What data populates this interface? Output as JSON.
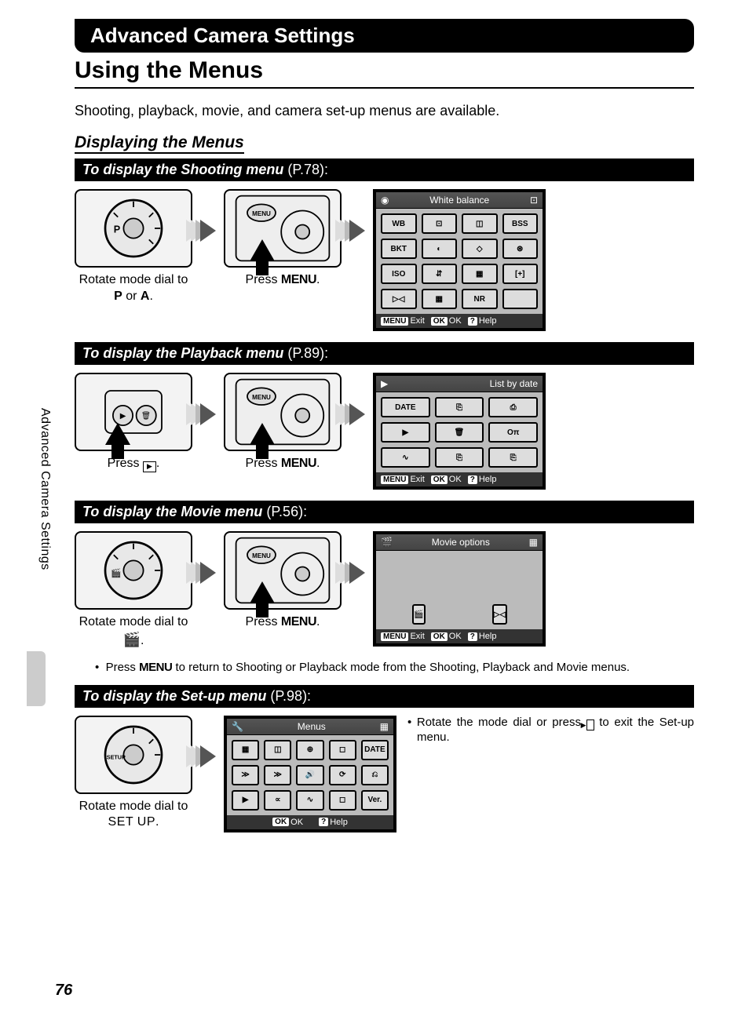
{
  "chapter": "Advanced Camera Settings",
  "section": "Using the Menus",
  "intro": "Shooting, playback, movie, and camera set-up menus are available.",
  "subhead": "Displaying the Menus",
  "side_tab": "Advanced Camera Settings",
  "page_number": "76",
  "bars": {
    "shooting": {
      "bold": "To display the Shooting menu",
      "ref": " (P.78):"
    },
    "playback": {
      "bold": "To display the Playback menu",
      "ref": " (P.89):"
    },
    "movie": {
      "bold": "To display the Movie menu",
      "ref": " (P.56):"
    },
    "setup": {
      "bold": "To display the Set-up menu",
      "ref": " (P.98):"
    }
  },
  "captions": {
    "rotate_pa_1": "Rotate mode dial to",
    "rotate_pa_2": "P or A.",
    "press_menu": "Press MENU.",
    "press_play": "Press ▶.",
    "rotate_movie_1": "Rotate mode dial to",
    "rotate_movie_2": "🎬.",
    "rotate_setup_1": "Rotate mode dial to",
    "rotate_setup_2": "SET UP."
  },
  "notes": {
    "menu_return": "• Press MENU to return to Shooting or Playback mode from the Shooting, Playback and Movie menus.",
    "setup_exit": "• Rotate the mode dial or press ▶ to exit the Set-up menu."
  },
  "screens": {
    "shooting": {
      "title": "White balance",
      "foot_exit": "Exit",
      "foot_ok": "OK",
      "foot_help": "Help",
      "icons": [
        "WB",
        "⊡",
        "◫",
        "BSS",
        "BKT",
        "◐",
        "◇",
        "⊛",
        "ISO",
        "⇵",
        "▦",
        "[+]",
        "▷◁",
        "▦",
        "NR",
        ""
      ]
    },
    "playback": {
      "title": "List by date",
      "foot_exit": "Exit",
      "foot_ok": "OK",
      "foot_help": "Help",
      "icons": [
        "DATE",
        "⎘",
        "⎙",
        "▶",
        "🗑",
        "Oπ",
        "∿",
        "⎘",
        "⎘"
      ]
    },
    "movie": {
      "title": "Movie options",
      "foot_exit": "Exit",
      "foot_ok": "OK",
      "foot_help": "Help",
      "icons": [
        "🎬",
        "▷◁"
      ]
    },
    "setup": {
      "title": "Menus",
      "foot_ok": "OK",
      "foot_help": "Help",
      "icons": [
        "▦",
        "◫",
        "⊕",
        "◻",
        "DATE",
        "≫",
        "≫",
        "🔊",
        "⟳",
        "⎌",
        "▶",
        "∝",
        "∿",
        "◻",
        "Ver."
      ]
    }
  }
}
